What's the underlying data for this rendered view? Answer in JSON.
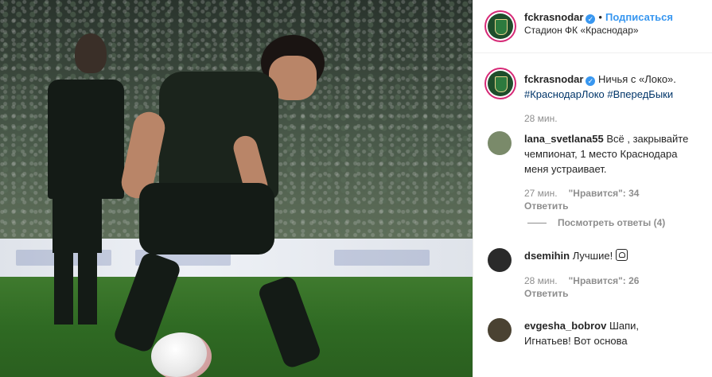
{
  "post": {
    "username": "fckrasnodar",
    "follow_label": "Подписаться",
    "location": "Стадион ФК «Краснодар»",
    "separator": "•"
  },
  "caption": {
    "username": "fckrasnodar",
    "text": "Ничья с «Локо».",
    "hashtags": "#КраснодарЛоко #ВпередБыки",
    "time": "28 мин."
  },
  "comments": [
    {
      "username": "lana_svetlana55",
      "text": "Всё , закрывайте чемпионат, 1 место Краснодара меня устраивает.",
      "time": "27 мин.",
      "likes_label": "\"Нравится\": 34",
      "reply_label": "Ответить",
      "view_replies": "Посмотреть ответы (4)"
    },
    {
      "username": "dsemihin",
      "text": "Лучшие!",
      "emoji": "scream-face",
      "time": "28 мин.",
      "likes_label": "\"Нравится\": 26",
      "reply_label": "Ответить"
    },
    {
      "username": "evgesha_bobrov",
      "text": "Шапи, Игнатьев! Вот основа"
    }
  ],
  "icons": {
    "verified": "verified-badge-icon",
    "avatar": "fc-krasnodar-crest"
  },
  "colors": {
    "accent": "#3897f0",
    "hashtag": "#003569",
    "muted": "#8e8e8e"
  }
}
